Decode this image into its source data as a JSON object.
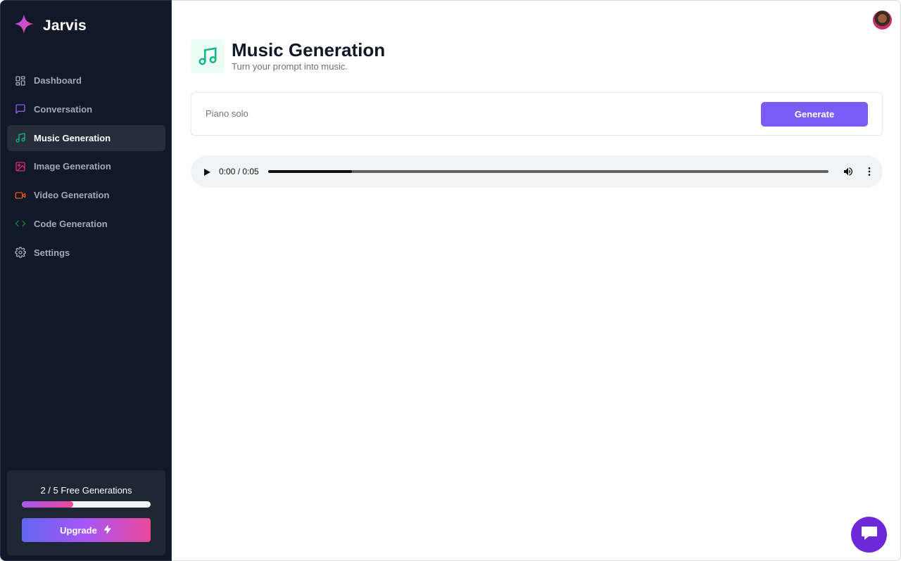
{
  "brand": {
    "name": "Jarvis",
    "icon": "sparkle-logo-icon"
  },
  "sidebar": {
    "items": [
      {
        "label": "Dashboard",
        "icon": "layout-grid-icon",
        "color": "#a4a9b4",
        "active": false
      },
      {
        "label": "Conversation",
        "icon": "message-square-icon",
        "color": "#8b5cf6",
        "active": false
      },
      {
        "label": "Music Generation",
        "icon": "music-icon",
        "color": "#10b981",
        "active": true
      },
      {
        "label": "Image Generation",
        "icon": "image-icon",
        "color": "#db2777",
        "active": false
      },
      {
        "label": "Video Generation",
        "icon": "video-icon",
        "color": "#ea580c",
        "active": false
      },
      {
        "label": "Code Generation",
        "icon": "code-icon",
        "color": "#15803d",
        "active": false
      },
      {
        "label": "Settings",
        "icon": "settings-icon",
        "color": "#a4a9b4",
        "active": false
      }
    ],
    "free_generations": {
      "text": "2 / 5 Free Generations",
      "used": 2,
      "total": 5
    },
    "upgrade_label": "Upgrade"
  },
  "header": {
    "title": "Music Generation",
    "subtitle": "Turn your prompt into music.",
    "icon": "music-icon",
    "accent": "#10b981"
  },
  "prompt": {
    "value": "Piano solo",
    "placeholder": "Piano solo"
  },
  "generate_label": "Generate",
  "audio": {
    "time": "0:00 / 0:05",
    "progress": 0.15
  },
  "colors": {
    "sidebar_bg": "#111827",
    "primary": "#7c5cf6",
    "chat_button": "#6d28d9"
  }
}
